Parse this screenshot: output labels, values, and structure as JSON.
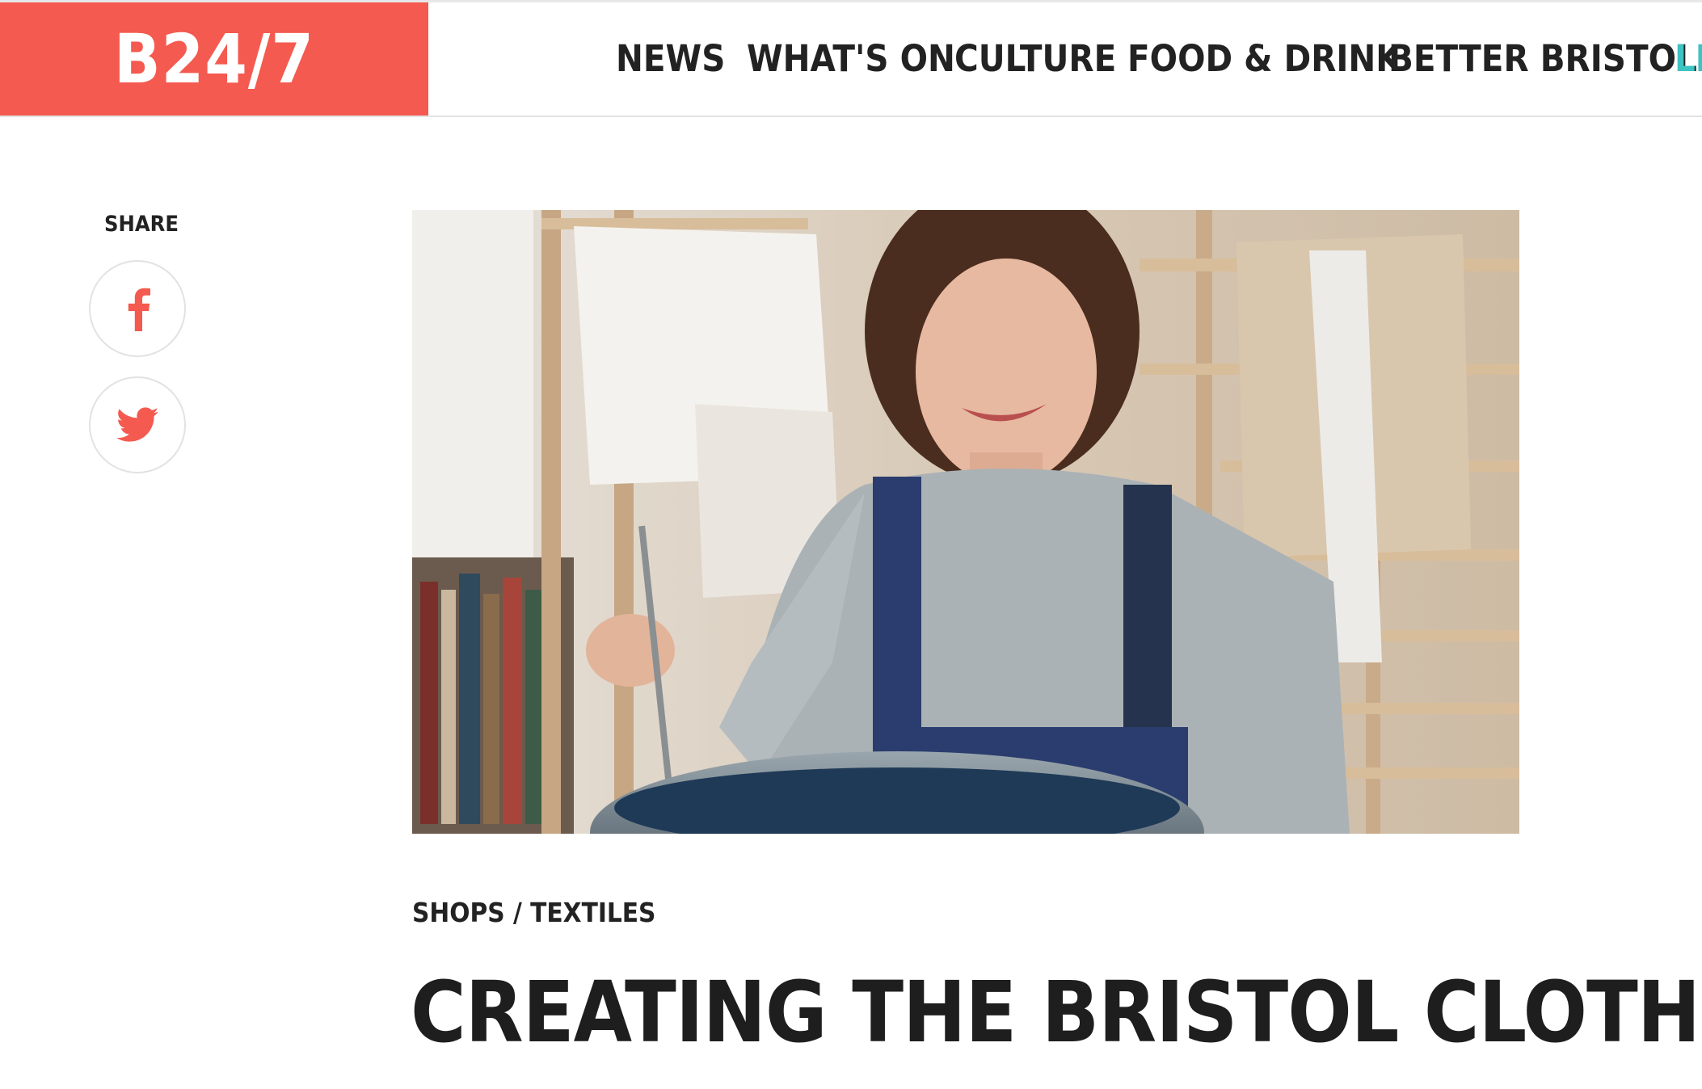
{
  "header": {
    "logo": "B24/7",
    "nav": [
      "NEWS",
      "WHAT'S ON",
      "CULTURE",
      "FOOD & DRINK",
      "BETTER BRISTOL",
      "LI"
    ]
  },
  "share": {
    "label": "SHARE",
    "buttons": [
      {
        "icon": "facebook-icon",
        "color": "#f45a4f"
      },
      {
        "icon": "twitter-icon",
        "color": "#f45a4f"
      }
    ]
  },
  "article": {
    "category_1": "SHOPS",
    "category_sep": " / ",
    "category_2": "TEXTILES",
    "title": "CREATING THE BRISTOL CLOTH"
  },
  "colors": {
    "brand": "#f45a4f",
    "accent": "#3cc3c2",
    "text": "#222222"
  }
}
